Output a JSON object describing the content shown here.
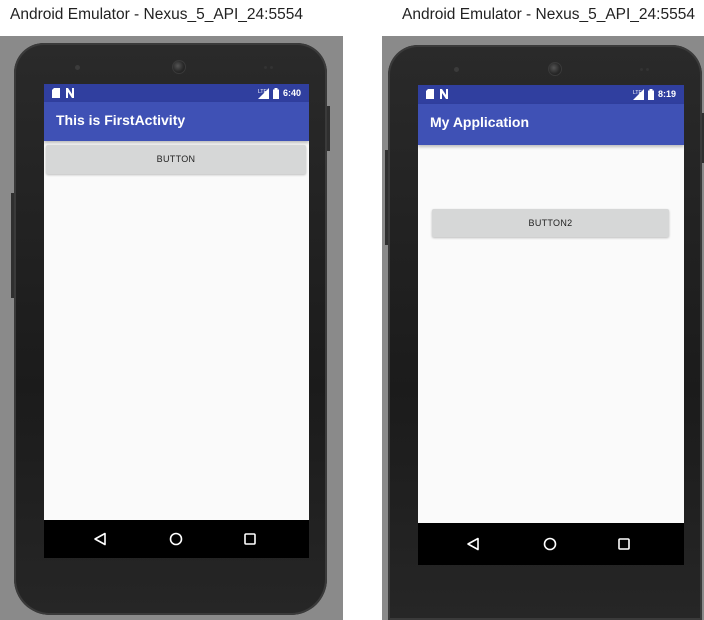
{
  "left_window": {
    "title": "Android Emulator - Nexus_5_API_24:5554",
    "status_time": "6:40",
    "app_title": "This is FirstActivity",
    "button_label": "BUTTON"
  },
  "right_window": {
    "title": "Android Emulator - Nexus_5_API_24:5554",
    "status_time": "8:19",
    "app_title": "My Application",
    "button_label": "BUTTON2"
  },
  "colors": {
    "status_bar": "#303f9f",
    "app_bar": "#3f51b5",
    "button_bg": "#d6d7d7",
    "screen_bg": "#fafafa",
    "nav_bar": "#000000"
  },
  "icons": {
    "status_left": [
      "sd-card-icon",
      "notification-n-icon"
    ],
    "status_right": [
      "signal-icon",
      "battery-icon"
    ],
    "nav": [
      "back-triangle-icon",
      "home-circle-icon",
      "recents-square-icon"
    ]
  }
}
